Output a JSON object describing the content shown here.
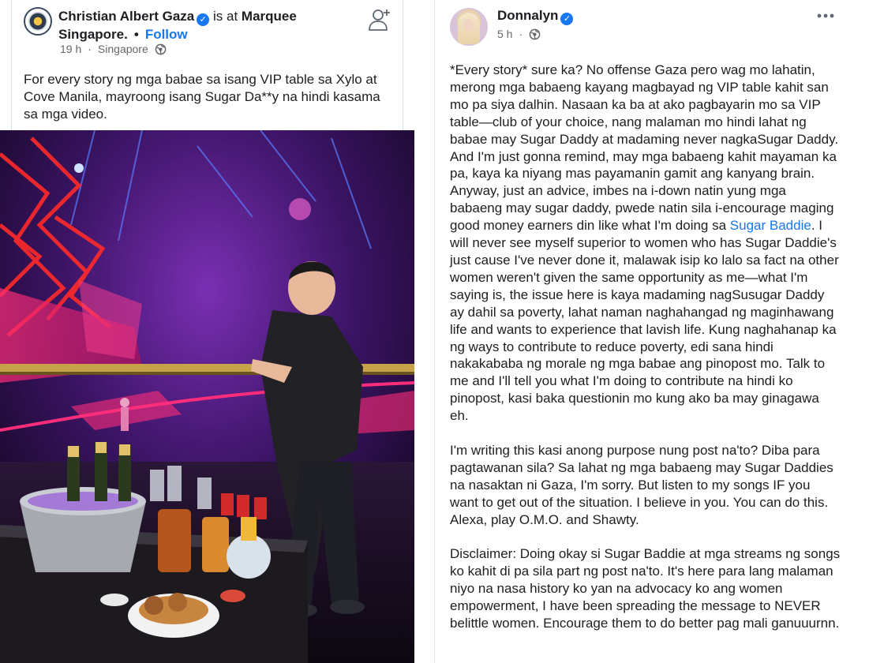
{
  "left_post": {
    "author": "Christian Albert Gaza",
    "is_at_text": "is at",
    "place_line1": "Marquee",
    "place_line2": "Singapore.",
    "dot": "•",
    "follow_label": "Follow",
    "time": "19 h",
    "meta_dot": "·",
    "location": "Singapore",
    "body_text": "For every story ng mga babae sa isang VIP table sa Xylo at Cove Manila, mayroong isang Sugar Da**y na hindi kasama sa mga video.",
    "photo_icon": "nightclub-photo",
    "add_friend_icon": "add-friend-icon"
  },
  "right_post": {
    "author": "Donnalyn",
    "time": "5 h",
    "meta_dot": "·",
    "paragraph1_part1": "*Every story* sure ka? No offense Gaza pero wag mo lahatin, merong mga babaeng kayang magbayad ng VIP table kahit san mo pa siya dalhin. Nasaan ka ba at ako pagbayarin mo sa VIP table—club of your choice, nang malaman mo hindi lahat ng babae may Sugar Daddy at madaming never nagkaSugar Daddy. And I'm just gonna remind, may mga babaeng kahit mayaman ka pa, kaya ka niyang mas payamanin gamit ang kanyang brain. Anyway, just an advice, imbes na i-down natin yung mga babaeng may sugar daddy, pwede natin sila i-encourage maging good money earners din like what I'm doing sa ",
    "link_text": "Sugar Baddie",
    "paragraph1_part2": ". I will never see myself superior to women who has Sugar Daddie's just cause I've never done it, malawak isip ko lalo sa fact na other women weren't given the same opportunity as me—what I'm saying is, the issue here is kaya madaming nagSusugar Daddy ay dahil sa poverty, lahat naman naghahangad ng maginhawang life and wants to experience that lavish life. Kung naghahanap ka ng ways to contribute to reduce poverty, edi sana hindi nakakababa ng morale ng mga babae ang pinopost mo. Talk to me and I'll tell you what I'm doing to contribute na hindi ko pinopost, kasi baka questionin mo kung ako ba may ginagawa eh.",
    "paragraph2": "I'm writing this kasi anong purpose nung post na'to? Diba para pagtawanan sila? Sa lahat ng mga babaeng may Sugar Daddies na nasaktan ni Gaza, I'm sorry. But listen to my songs IF you want to get out of the situation. I believe in you. You can do this. Alexa, play O.M.O. and Shawty.",
    "paragraph3": "Disclaimer: Doing okay si Sugar Baddie at mga streams ng songs ko kahit di pa sila part ng post na'to. It's here para lang malaman niyo na nasa history ko yan na advocacy ko ang women empowerment, I have been spreading the message to NEVER belittle women. Encourage them to do better pag mali ganuuurnn."
  },
  "icons": {
    "verified": "verified-badge-icon",
    "globe": "globe-icon",
    "more": "more-options-icon"
  },
  "colors": {
    "link": "#1877f2",
    "meta": "#65676b",
    "text": "#1c1e21"
  }
}
